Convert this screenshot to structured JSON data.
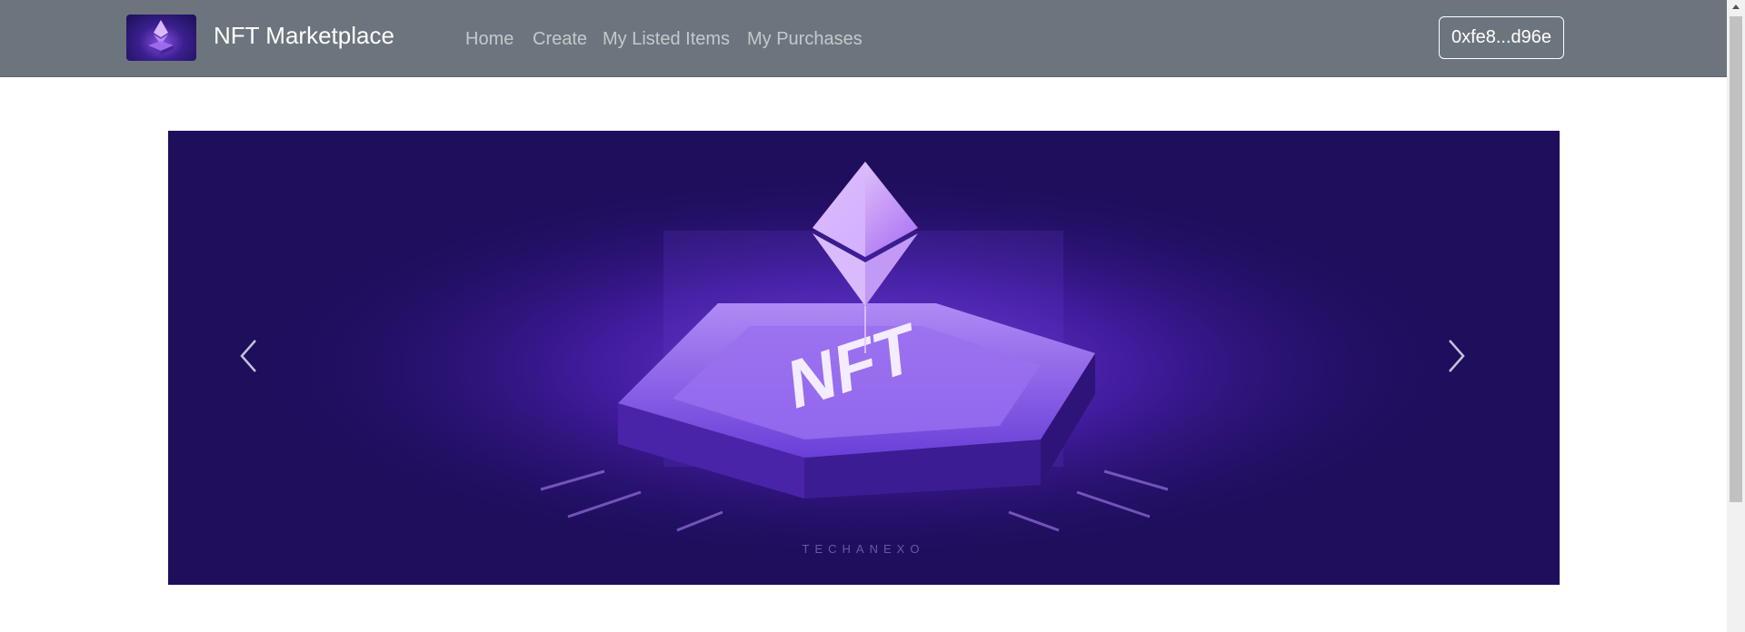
{
  "navbar": {
    "brand_title": "NFT Marketplace",
    "links": [
      {
        "label": "Home"
      },
      {
        "label": "Create"
      },
      {
        "label": "My Listed Items"
      },
      {
        "label": "My Purchases"
      }
    ],
    "wallet_button_label": "0xfe8...d96e",
    "brand_logo_icon": "ethereum-logo-icon"
  },
  "carousel": {
    "slide_image_text": "NFT",
    "slide_watermark": "TECHANEXO",
    "prev_icon": "chevron-left-icon",
    "next_icon": "chevron-right-icon"
  },
  "colors": {
    "navbar_bg": "#6c757d",
    "slide_bg": "#1e0e5c",
    "accent": "#8a4fe0"
  }
}
